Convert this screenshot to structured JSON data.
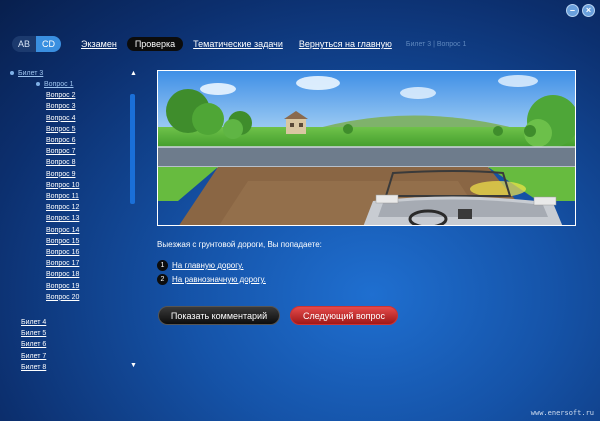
{
  "window": {
    "minimize_label": "–",
    "close_label": "×"
  },
  "nav": {
    "category_ab": "AB",
    "category_cd": "CD",
    "exam": "Экзамен",
    "check": "Проверка",
    "topics": "Тематические задачи",
    "home": "Вернуться на главную",
    "breadcrumb": "Билет 3 | Вопрос 1"
  },
  "sidebar": {
    "current_ticket": "Билет 3",
    "questions": [
      "Вопрос 1",
      "Вопрос 2",
      "Вопрос 3",
      "Вопрос 4",
      "Вопрос 5",
      "Вопрос 6",
      "Вопрос 7",
      "Вопрос 8",
      "Вопрос 9",
      "Вопрос 10",
      "Вопрос 11",
      "Вопрос 12",
      "Вопрос 13",
      "Вопрос 14",
      "Вопрос 15",
      "Вопрос 16",
      "Вопрос 17",
      "Вопрос 18",
      "Вопрос 19",
      "Вопрос 20"
    ],
    "tickets": [
      "Билет 4",
      "Билет 5",
      "Билет 6",
      "Билет 7",
      "Билет 8"
    ],
    "scroll_up": "▲",
    "scroll_down": "▼"
  },
  "question": {
    "text": "Выезжая с грунтовой дороги, Вы попадаете:",
    "answers": [
      {
        "num": "1",
        "text": "На главную дорогу."
      },
      {
        "num": "2",
        "text": "На равнозначную дорогу."
      }
    ]
  },
  "buttons": {
    "comment": "Показать комментарий",
    "next": "Следующий вопрос"
  },
  "watermark": "www.enersoft.ru",
  "colors": {
    "accent": "#3a8fe0",
    "next_button": "#c42424",
    "background": "#1553a8"
  }
}
